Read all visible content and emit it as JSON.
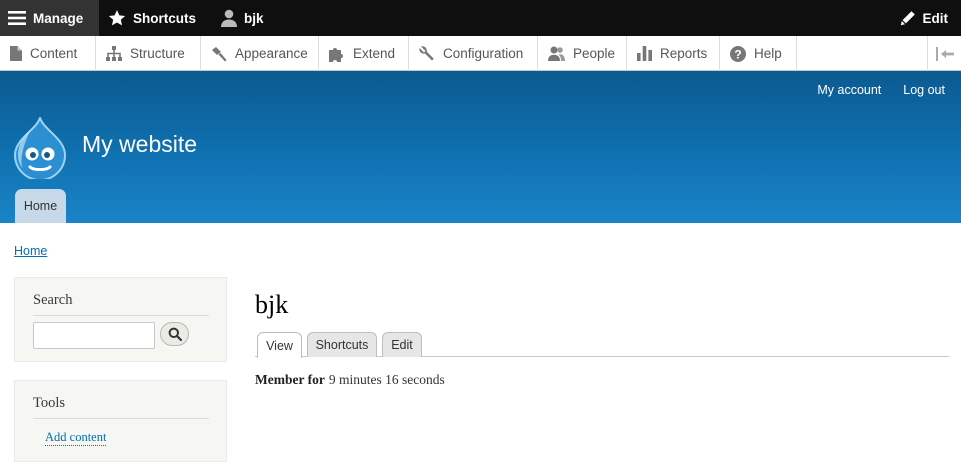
{
  "toolbar": {
    "manage_label": "Manage",
    "shortcuts_label": "Shortcuts",
    "user_label": "bjk",
    "edit_label": "Edit"
  },
  "tray": {
    "items": [
      {
        "label": "Content",
        "icon": "file-icon"
      },
      {
        "label": "Structure",
        "icon": "sitemap-icon"
      },
      {
        "label": "Appearance",
        "icon": "paintbrush-icon"
      },
      {
        "label": "Extend",
        "icon": "puzzle-icon"
      },
      {
        "label": "Configuration",
        "icon": "wrench-icon"
      },
      {
        "label": "People",
        "icon": "people-icon"
      },
      {
        "label": "Reports",
        "icon": "bar-chart-icon"
      },
      {
        "label": "Help",
        "icon": "help-icon"
      }
    ]
  },
  "header": {
    "site_name": "My website",
    "my_account": "My account",
    "log_out": "Log out",
    "primary_tab": "Home"
  },
  "breadcrumb": "Home",
  "sidebar": {
    "search_title": "Search",
    "search_value": "",
    "tools_title": "Tools",
    "add_content": "Add content"
  },
  "main": {
    "title": "bjk",
    "tabs": [
      "View",
      "Shortcuts",
      "Edit"
    ],
    "member_label": "Member for",
    "member_value": "9 minutes 16 seconds"
  },
  "colors": {
    "toolbar_bg": "#0f0f0f",
    "header_top": "#0b5a91",
    "header_bottom": "#1a84c7",
    "link": "#0071b3"
  }
}
